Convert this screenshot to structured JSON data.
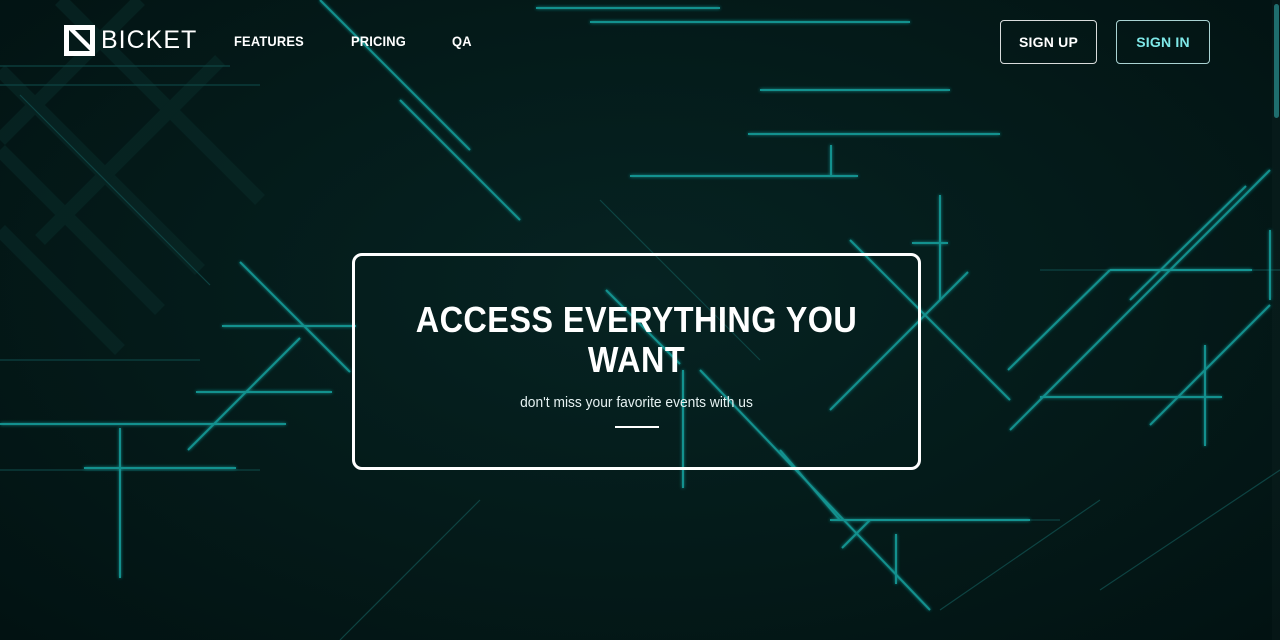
{
  "brand": {
    "name": "BICKET",
    "accent_color": "#18b3b3"
  },
  "nav": {
    "items": [
      {
        "label": "FEATURES"
      },
      {
        "label": "PRICING"
      },
      {
        "label": "QA"
      }
    ]
  },
  "auth": {
    "signup_label": "SIGN UP",
    "signin_label": "SIGN IN"
  },
  "hero": {
    "title": "ACCESS EVERYTHING YOU WANT",
    "subtitle": "don't miss your favorite events with us"
  }
}
